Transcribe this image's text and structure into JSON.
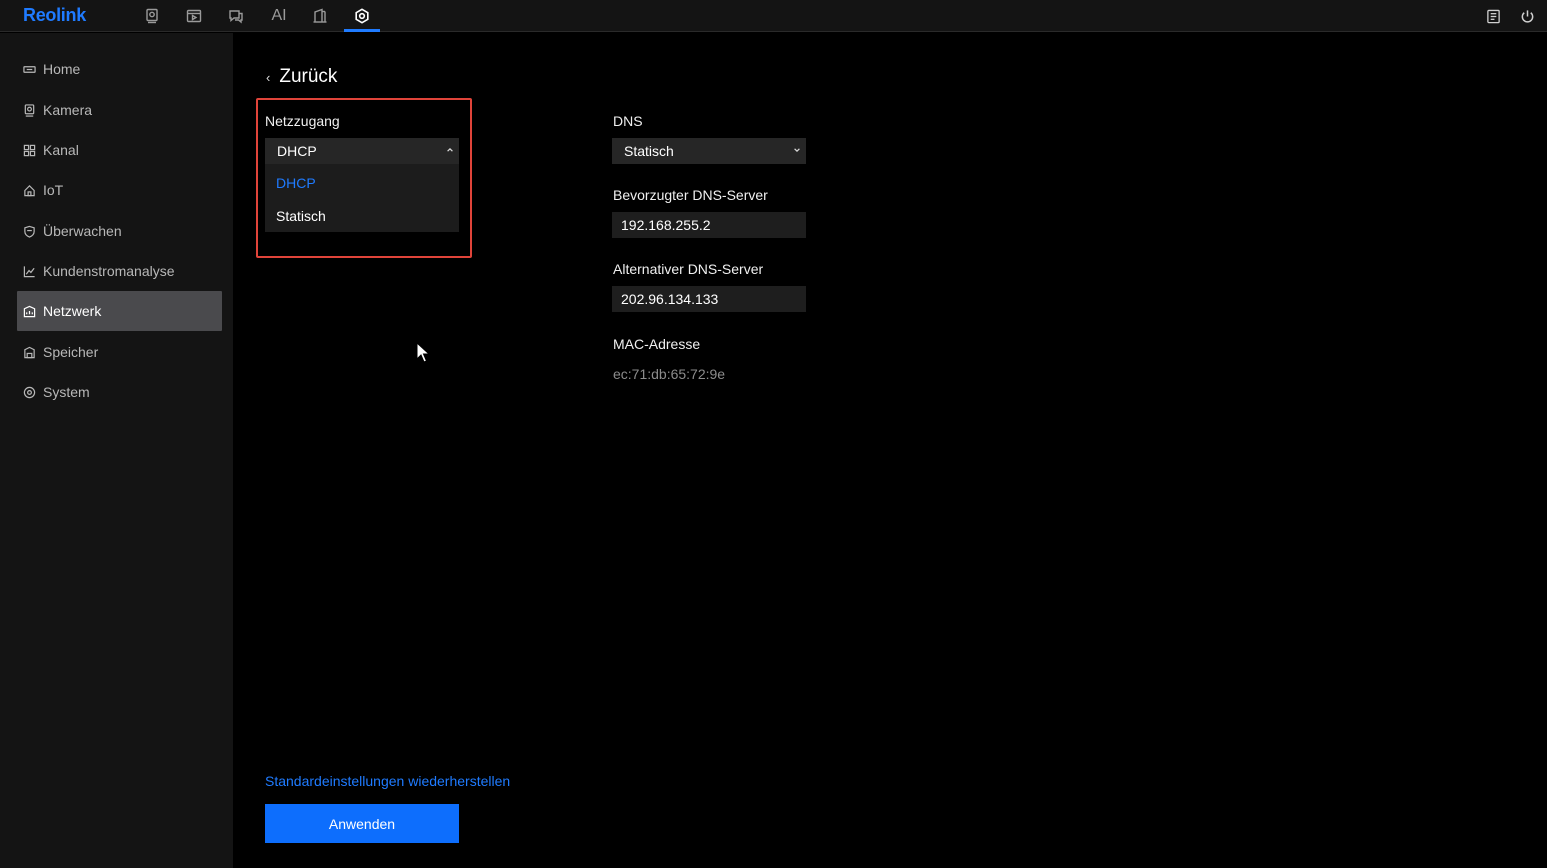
{
  "brand": {
    "logo": "Reolink",
    "accent": "#1f7bff"
  },
  "topnav": {
    "items": [
      {
        "icon": "camera-preview-icon"
      },
      {
        "icon": "playback-icon"
      },
      {
        "icon": "message-icon"
      },
      {
        "label": "AI",
        "icon": "ai-icon"
      },
      {
        "icon": "door-icon"
      },
      {
        "icon": "settings-icon",
        "active": true
      }
    ],
    "right": [
      {
        "icon": "notes-icon"
      },
      {
        "icon": "power-icon"
      }
    ]
  },
  "sidebar": {
    "items": [
      {
        "label": "Home",
        "icon": "monitor-icon"
      },
      {
        "label": "Kamera",
        "icon": "camera-icon"
      },
      {
        "label": "Kanal",
        "icon": "grid-icon"
      },
      {
        "label": "IoT",
        "icon": "house-icon"
      },
      {
        "label": "Überwachen",
        "icon": "shield-icon"
      },
      {
        "label": "Kundenstromanalyse",
        "icon": "chart-icon"
      },
      {
        "label": "Netzwerk",
        "icon": "network-icon",
        "active": true
      },
      {
        "label": "Speicher",
        "icon": "storage-icon"
      },
      {
        "label": "System",
        "icon": "gear-icon"
      }
    ]
  },
  "main": {
    "back_label": "Zurück",
    "netzzugang": {
      "label": "Netzzugang",
      "value": "DHCP",
      "options": [
        "DHCP",
        "Statisch"
      ],
      "selected_option": "DHCP"
    },
    "dns": {
      "label": "DNS",
      "value": "Statisch"
    },
    "preferred_dns": {
      "label": "Bevorzugter DNS-Server",
      "value": "192.168.255.2"
    },
    "alternate_dns": {
      "label": "Alternativer DNS-Server",
      "value": "202.96.134.133"
    },
    "mac": {
      "label": "MAC-Adresse",
      "value": "ec:71:db:65:72:9e"
    },
    "restore_defaults": "Standardeinstellungen wiederherstellen",
    "apply_button": "Anwenden"
  }
}
